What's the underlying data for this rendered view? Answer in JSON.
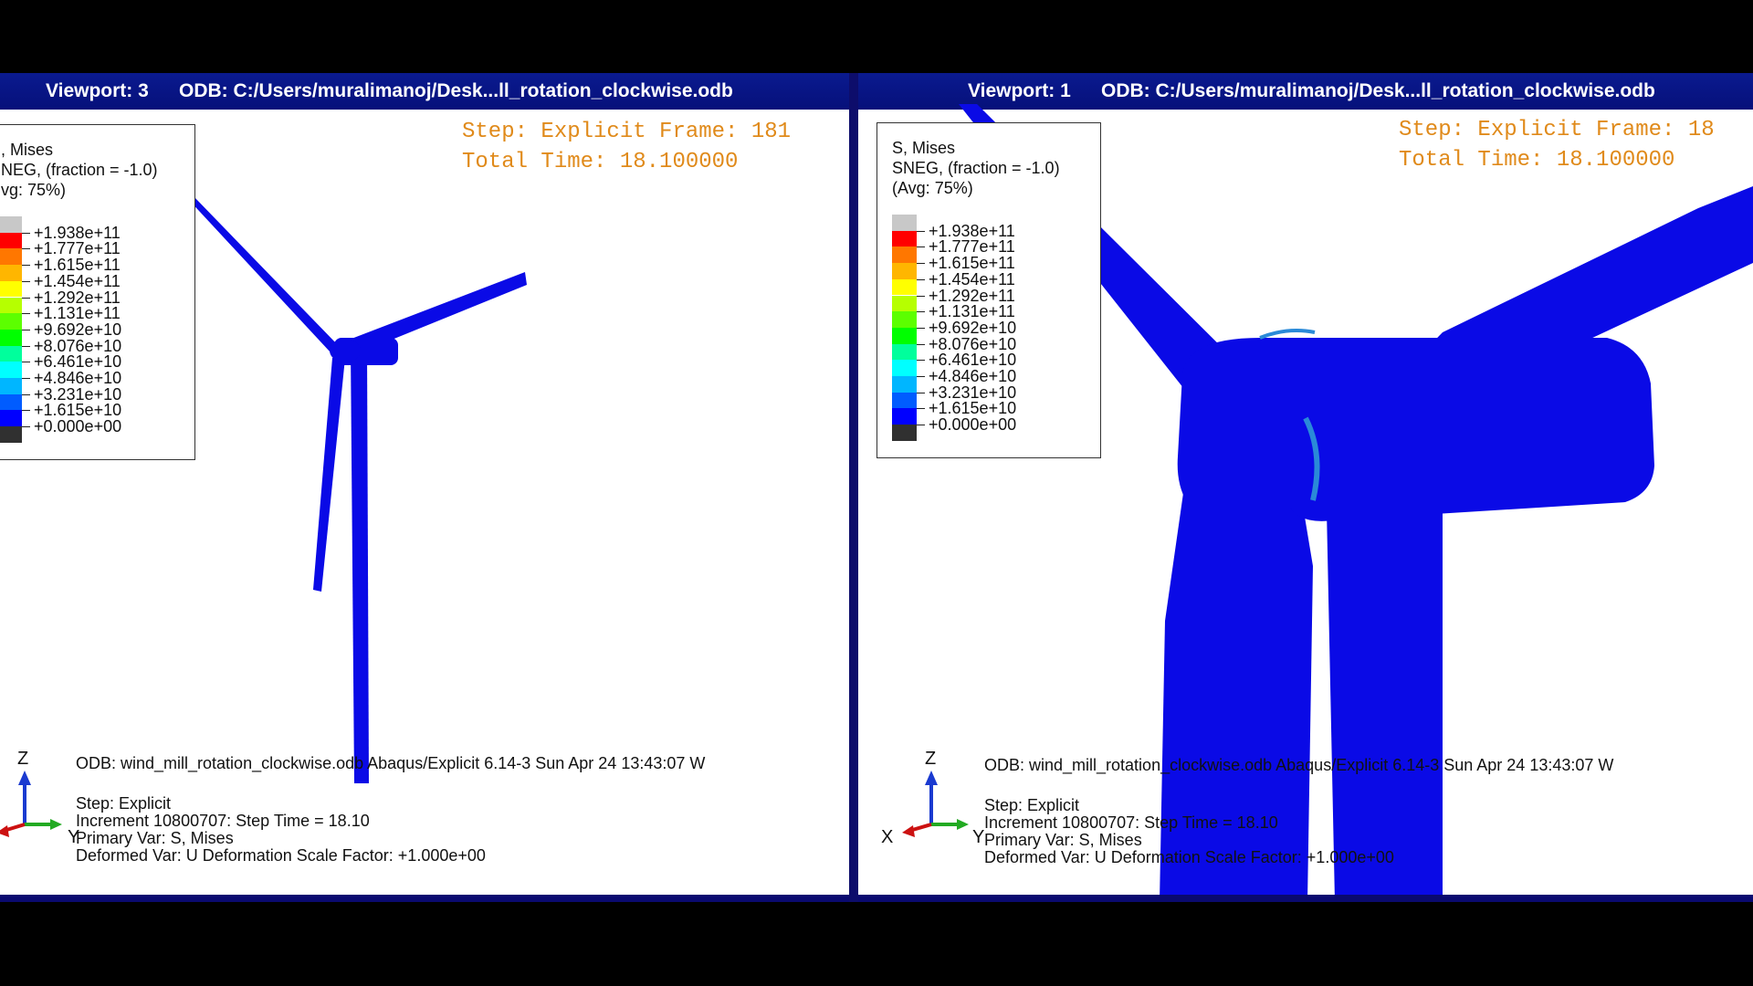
{
  "legend": {
    "scale_colors": [
      "#c8c8c8",
      "#ff0000",
      "#ff7700",
      "#ffb600",
      "#ffff00",
      "#b6ff00",
      "#5cff00",
      "#00ff00",
      "#00ff9c",
      "#00ffff",
      "#00b6ff",
      "#005cff",
      "#0000ff",
      "#303030"
    ],
    "values": [
      "+1.938e+11",
      "+1.777e+11",
      "+1.615e+11",
      "+1.454e+11",
      "+1.292e+11",
      "+1.131e+11",
      "+9.692e+10",
      "+8.076e+10",
      "+6.461e+10",
      "+4.846e+10",
      "+3.231e+10",
      "+1.615e+10",
      "+0.000e+00"
    ]
  },
  "viewport3": {
    "label": "Viewport: 3",
    "odb": "ODB: C:/Users/muralimanoj/Desk...ll_rotation_clockwise.odb",
    "legend_title": [
      ", Mises",
      "NEG, (fraction = -1.0)",
      "vg: 75%)"
    ],
    "step_line": "Step: Explicit Frame: 181",
    "time_line": "Total Time: 18.100000",
    "info_lines": [
      "ODB: wind_mill_rotation_clockwise.odb     Abaqus/Explicit 6.14-3     Sun Apr 24 13:43:07 W",
      "Step: Explicit",
      "Increment  10800707: Step Time =     18.10",
      "Primary Var: S, Mises",
      "Deformed Var: U   Deformation Scale Factor: +1.000e+00"
    ],
    "axes": {
      "z": "Z",
      "y": "Y"
    }
  },
  "viewport1": {
    "label": "Viewport: 1",
    "odb": "ODB: C:/Users/muralimanoj/Desk...ll_rotation_clockwise.odb",
    "legend_title": [
      "S, Mises",
      "SNEG, (fraction = -1.0)",
      "(Avg: 75%)"
    ],
    "step_line": "Step: Explicit Frame: 18",
    "time_line": "Total Time: 18.100000",
    "info_lines": [
      "ODB: wind_mill_rotation_clockwise.odb     Abaqus/Explicit 6.14-3     Sun Apr 24 13:43:07 W",
      "Step: Explicit",
      "Increment  10800707: Step Time =     18.10",
      "Primary Var: S, Mises",
      "Deformed Var: U   Deformation Scale Factor: +1.000e+00"
    ],
    "axes": {
      "z": "Z",
      "x": "X",
      "y": "Y"
    }
  },
  "colors": {
    "model_blue": "#0a0ae6",
    "hub_highlight": "#2a8ad8",
    "title_bar": "#0a1a8f",
    "state_text": "#e08a1a"
  }
}
